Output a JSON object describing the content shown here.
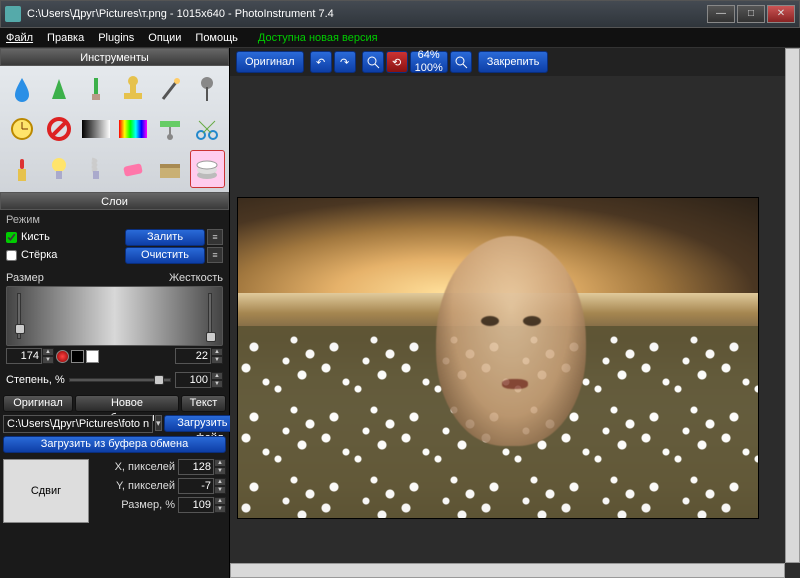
{
  "window": {
    "title": "C:\\Users\\Друг\\Pictures\\т.png - 1015x640 - PhotoInstrument 7.4"
  },
  "menu": {
    "file": "Файл",
    "edit": "Правка",
    "plugins": "Plugins",
    "options": "Опции",
    "help": "Помощь",
    "newversion": "Доступна новая версия"
  },
  "panels": {
    "tools": "Инструменты",
    "layers": "Слои"
  },
  "mode": {
    "header": "Режим",
    "brush": "Кисть",
    "eraser": "Стёрка",
    "fill": "Залить",
    "clear": "Очистить"
  },
  "sizes": {
    "size": "Размер",
    "hard": "Жесткость",
    "sizeval": "174",
    "hardval": "22"
  },
  "degree": {
    "label": "Степень, %",
    "value": "100"
  },
  "tabs": {
    "original": "Оригинал",
    "newimg": "Новое изображение",
    "text": "Текст"
  },
  "loader": {
    "path": "C:\\Users\\Друг\\Pictures\\foto na",
    "loadfile": "Загрузить из файл",
    "loadclip": "Загрузить из буфера обмена",
    "shift": "Сдвиг",
    "xpx": "X, пикселей",
    "ypx": "Y, пикселей",
    "sizep": "Размер, %",
    "x": "128",
    "y": "-7",
    "s": "109"
  },
  "topbar": {
    "original": "Оригинал",
    "zoom1": "64%",
    "zoom2": "100%",
    "pin": "Закрепить"
  },
  "icons": {
    "t0": "drop-icon",
    "t1": "tree-icon",
    "t2": "brush-icon",
    "t3": "stamp-icon",
    "t4": "wand-icon",
    "t5": "pin-icon",
    "t6": "clock-icon",
    "t7": "nosign-icon",
    "t8": "bw-gradient-icon",
    "t9": "spectrum-icon",
    "t10": "scale-icon",
    "t11": "scissors-icon",
    "t12": "lipstick-icon",
    "t13": "bulb-icon",
    "t14": "spiral-bulb-icon",
    "t15": "eraser-icon",
    "t16": "package-icon",
    "t17": "layers-icon"
  }
}
